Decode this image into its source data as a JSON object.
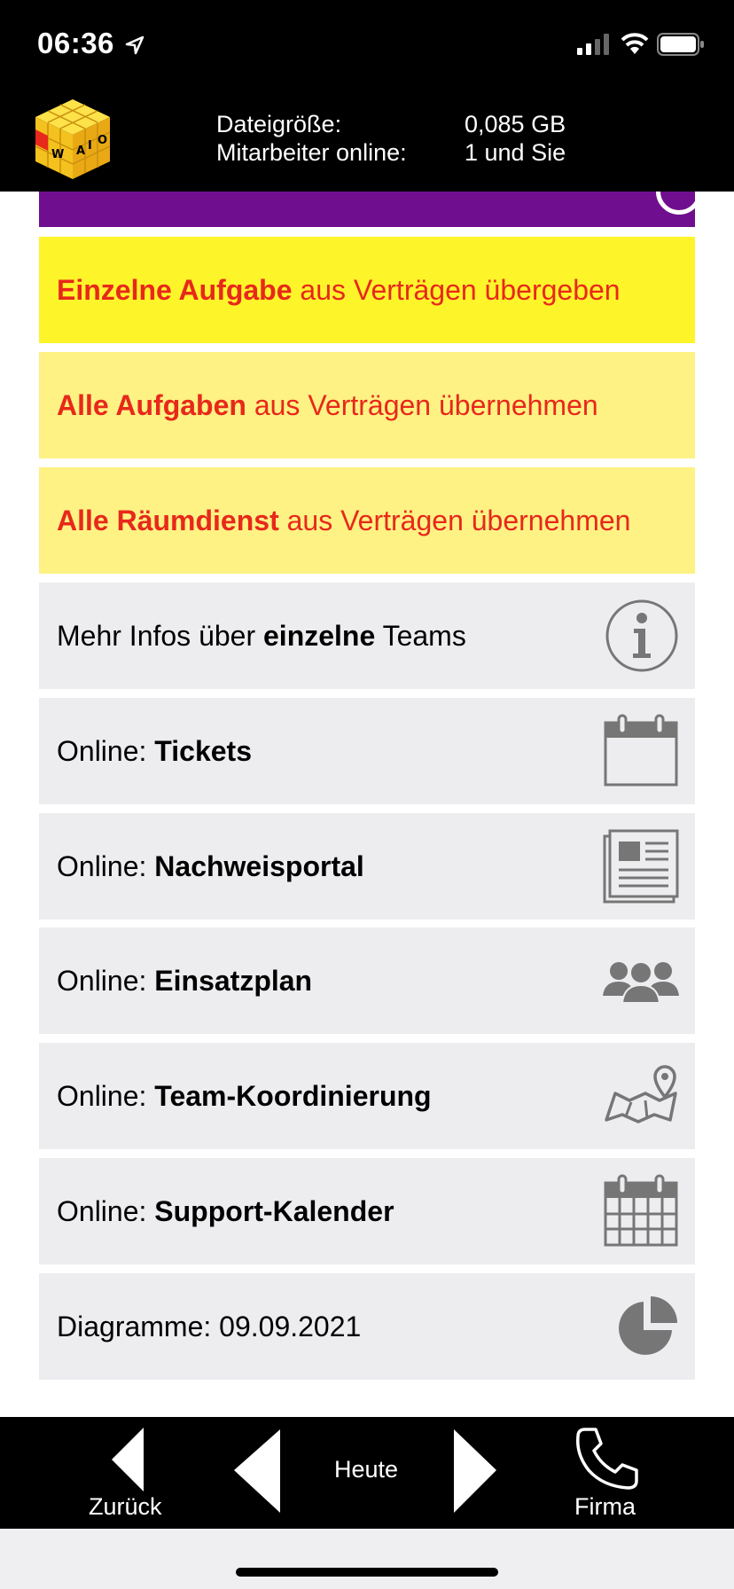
{
  "status": {
    "time": "06:36"
  },
  "header": {
    "file_size_label": "Dateigröße:",
    "file_size_value": "0,085 GB",
    "staff_label": "Mitarbeiter online:",
    "staff_value": "1 und Sie"
  },
  "items": [
    {
      "bold": "Einzelne Aufgabe",
      "rest": " aus Verträgen übergeben"
    },
    {
      "bold": "Alle Aufgaben",
      "rest": " aus Verträgen übernehmen"
    },
    {
      "bold": "Alle Räumdienst",
      "rest": " aus Verträgen übernehmen"
    },
    {
      "pre": "Mehr Infos über ",
      "bold": "einzelne",
      "post": " Teams",
      "icon": "info-icon"
    },
    {
      "pre": "Online: ",
      "bold": "Tickets",
      "icon": "calendar-icon"
    },
    {
      "pre": "Online: ",
      "bold": "Nachweisportal",
      "icon": "newspaper-icon"
    },
    {
      "pre": "Online: ",
      "bold": "Einsatzplan",
      "icon": "group-icon"
    },
    {
      "pre": "Online: ",
      "bold": "Team-Koordinierung",
      "icon": "map-icon"
    },
    {
      "pre": "Online: ",
      "bold": "Support-Kalender",
      "icon": "calendar-grid-icon"
    },
    {
      "text": "Diagramme: 09.09.2021",
      "icon": "pie-chart-icon"
    }
  ],
  "bottom_nav": {
    "back": "Zurück",
    "today": "Heute",
    "company": "Firma"
  },
  "colors": {
    "header_bg": "#000000",
    "purple": "#6f0f8f",
    "yellow": "#fef42a",
    "yellow_light": "#fdf283",
    "red_text": "#e8281b",
    "gray_item": "#ededf0",
    "icon_gray": "#767676"
  }
}
